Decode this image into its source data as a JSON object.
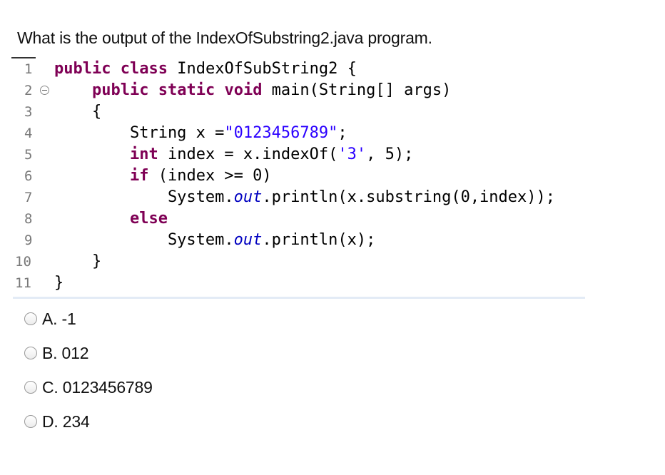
{
  "question": {
    "text": "What is the output of the IndexOfSubstring2.java program."
  },
  "code": {
    "lines": [
      {
        "num": "1",
        "parts": [
          {
            "t": "public",
            "c": "kw"
          },
          {
            "t": " "
          },
          {
            "t": "class",
            "c": "kw"
          },
          {
            "t": " IndexOfSubString2 {"
          }
        ]
      },
      {
        "num": "2",
        "fold": true,
        "parts": [
          {
            "t": "    "
          },
          {
            "t": "public",
            "c": "kw"
          },
          {
            "t": " "
          },
          {
            "t": "static",
            "c": "kw"
          },
          {
            "t": " "
          },
          {
            "t": "void",
            "c": "kw"
          },
          {
            "t": " main(String[] args)"
          }
        ]
      },
      {
        "num": "3",
        "parts": [
          {
            "t": "    {"
          }
        ]
      },
      {
        "num": "4",
        "parts": [
          {
            "t": "        String x ="
          },
          {
            "t": "\"0123456789\"",
            "c": "str"
          },
          {
            "t": ";"
          }
        ]
      },
      {
        "num": "5",
        "parts": [
          {
            "t": "        "
          },
          {
            "t": "int",
            "c": "kw"
          },
          {
            "t": " index = x.indexOf("
          },
          {
            "t": "'3'",
            "c": "str"
          },
          {
            "t": ", 5);"
          }
        ]
      },
      {
        "num": "6",
        "parts": [
          {
            "t": "        "
          },
          {
            "t": "if",
            "c": "kw"
          },
          {
            "t": " (index >= 0)"
          }
        ]
      },
      {
        "num": "7",
        "parts": [
          {
            "t": "            System."
          },
          {
            "t": "out",
            "c": "fld"
          },
          {
            "t": ".println(x.substring(0,index));"
          }
        ]
      },
      {
        "num": "8",
        "parts": [
          {
            "t": "        "
          },
          {
            "t": "else",
            "c": "kw"
          }
        ]
      },
      {
        "num": "9",
        "parts": [
          {
            "t": "            System."
          },
          {
            "t": "out",
            "c": "fld"
          },
          {
            "t": ".println(x);"
          }
        ]
      },
      {
        "num": "10",
        "parts": [
          {
            "t": "    }"
          }
        ]
      },
      {
        "num": "11",
        "parts": [
          {
            "t": "}"
          }
        ]
      }
    ]
  },
  "options": [
    {
      "label": "A. -1"
    },
    {
      "label": "B. 012"
    },
    {
      "label": "C. 0123456789"
    },
    {
      "label": "D. 234"
    }
  ],
  "colors": {
    "keyword": "#7f0055",
    "string": "#2a00ff",
    "field": "#0000c0",
    "line_number": "#787878"
  }
}
